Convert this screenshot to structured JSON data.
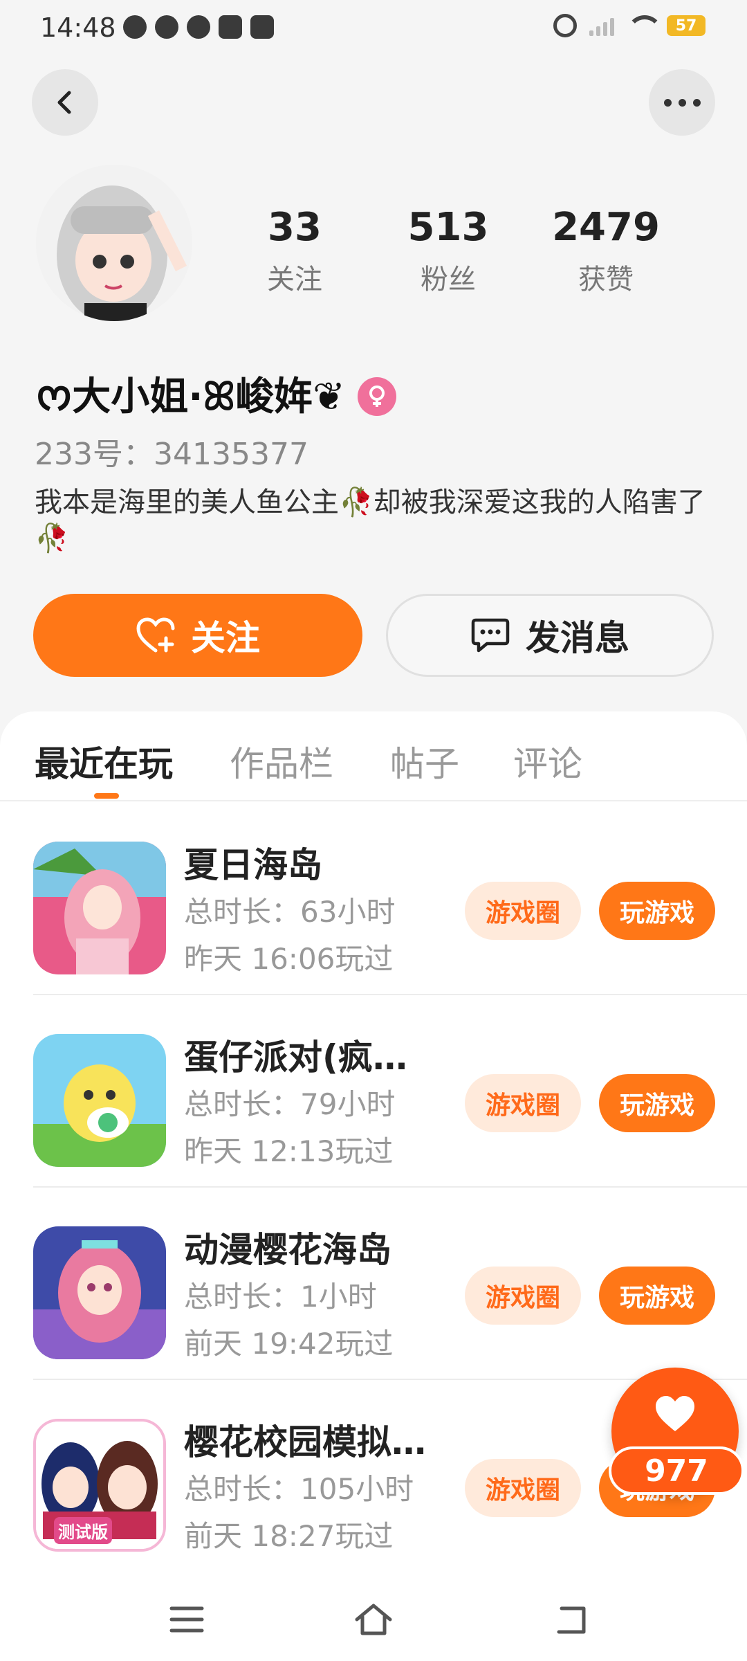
{
  "status_bar": {
    "time": "14:48",
    "battery": "57"
  },
  "profile": {
    "username": "ᰔ大小姐·ꕤ峻姩❦",
    "uid": "233号：34135377",
    "bio": "我本是海里的美人鱼公主🥀却被我深爱这我的人陷害了🥀",
    "stats": [
      {
        "value": "33",
        "label": "关注"
      },
      {
        "value": "513",
        "label": "粉丝"
      },
      {
        "value": "2479",
        "label": "获赞"
      }
    ],
    "follow_label": "关注",
    "message_label": "发消息"
  },
  "tabs": [
    "最近在玩",
    "作品栏",
    "帖子",
    "评论"
  ],
  "games": [
    {
      "name": "夏日海岛",
      "duration": "总时长：63小时",
      "last_played": "昨天 16:06玩过",
      "circle_label": "游戏圈",
      "play_label": "玩游戏"
    },
    {
      "name": "蛋仔派对(疯…",
      "duration": "总时长：79小时",
      "last_played": "昨天 12:13玩过",
      "circle_label": "游戏圈",
      "play_label": "玩游戏"
    },
    {
      "name": "动漫樱花海岛",
      "duration": "总时长：1小时",
      "last_played": "前天 19:42玩过",
      "circle_label": "游戏圈",
      "play_label": "玩游戏"
    },
    {
      "name": "樱花校园模拟…",
      "duration": "总时长：105小时",
      "last_played": "前天 18:27玩过",
      "circle_label": "游戏圈",
      "play_label": "玩游戏",
      "icon_badge": "测试版"
    }
  ],
  "like_count": "977",
  "colors": {
    "accent": "#ff7717",
    "accent_light": "#ffeadb",
    "gender": "#f0709b"
  }
}
